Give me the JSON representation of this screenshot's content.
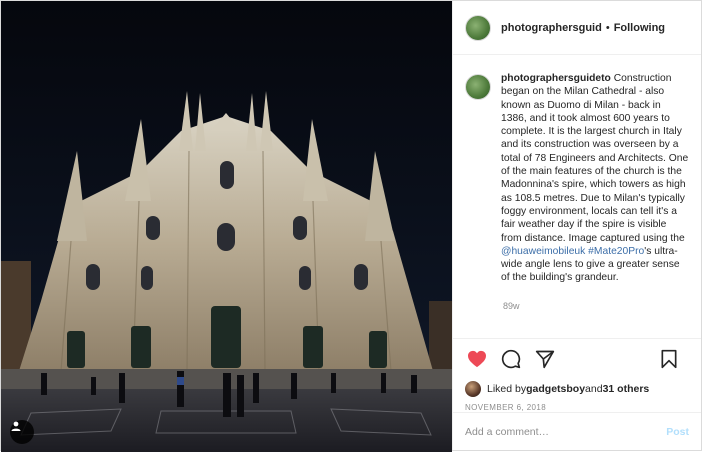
{
  "header": {
    "username": "photographersguid",
    "separator": "•",
    "follow_status": "Following"
  },
  "caption": {
    "username": "photographersguideto",
    "text_part1": " Construction began on the Milan Cathedral - also known as Duomo di Milan - back in 1386, and it took almost 600 years to complete. It is the largest church in Italy and its construction was overseen by a total of 78 Engineers and Architects. One of the main features of the church is the Madonnina's spire, which towers as high as 108.5 metres. Due to Milan's typically foggy environment, locals can tell it's a fair weather day if the spire is visible from distance. Image captured using the ",
    "mention": "@huaweimobileuk",
    "text_part2": " ",
    "hashtag": "#Mate20Pro",
    "text_part3": "'s ultra-wide angle lens to give a greater sense of the building's grandeur.",
    "time_ago": "89w"
  },
  "likes": {
    "prefix": "Liked by ",
    "user": "gadgetsboy",
    "middle": " and ",
    "others": "31 others"
  },
  "date": "NOVEMBER 6, 2018",
  "comment": {
    "placeholder": "Add a comment…",
    "post_label": "Post"
  },
  "icons": {
    "like": "heart-filled-icon",
    "comment": "comment-icon",
    "share": "share-icon",
    "save": "bookmark-icon",
    "tag": "user-tag-icon"
  },
  "colors": {
    "like_red": "#ed4956",
    "link_blue": "#3c6ea8",
    "post_disabled": "#b2dffc",
    "meta_gray": "#8e8e8e"
  }
}
